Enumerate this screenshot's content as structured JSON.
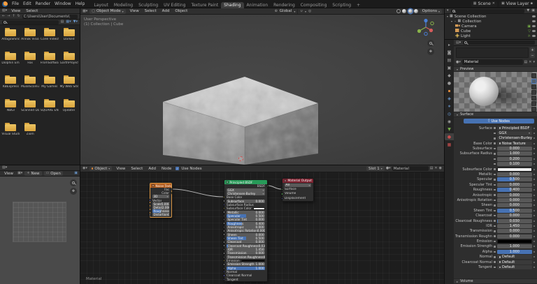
{
  "topbar": {
    "menus": [
      "File",
      "Edit",
      "Render",
      "Window",
      "Help"
    ],
    "tabs": [
      "Layout",
      "Modeling",
      "Sculpting",
      "UV Editing",
      "Texture Paint",
      "Shading",
      "Animation",
      "Rendering",
      "Compositing",
      "Scripting"
    ],
    "active_tab": "Shading",
    "add_tab": "+",
    "scene": "Scene",
    "view_layer": "View Layer"
  },
  "file_browser": {
    "menus": [
      "View",
      "Select"
    ],
    "path": "C:\\Users\\User\\Documents\\",
    "folders": [
      "AltagoShinc",
      "Annok Vision",
      "Corel VideoSt..",
      "Darked",
      "Dolphin Emul..",
      "Fax",
      "FromSoftware",
      "GarthProject",
      "KBExpress",
      "MuseScore3",
      "My Games",
      "My Web Sites",
      "NBGI",
      "Scanned Doc..",
      "SQUARE ENIX",
      "Updater",
      "Visual Studi..",
      "Ziom"
    ]
  },
  "viewport": {
    "mode": "Object Mode",
    "menus": [
      "View",
      "Select",
      "Add",
      "Object"
    ],
    "orientation": "Global",
    "options": "Options",
    "overlay_line1": "User Perspective",
    "overlay_line2": "(1) Collection | Cube"
  },
  "image_editor": {
    "view_menu": "View",
    "new_button": "New",
    "open_button": "Open"
  },
  "node_editor": {
    "shader_type": "Object",
    "menus": [
      "View",
      "Select",
      "Add",
      "Node"
    ],
    "use_nodes": "Use Nodes",
    "slot": "Slot 1",
    "material_name": "Material",
    "breadcrumb": "Material",
    "noise_node": {
      "title": "Noise Texture",
      "outputs": [
        {
          "label": "Fac",
          "socket": "value"
        },
        {
          "label": "Color",
          "socket": "color"
        }
      ],
      "dimensions": "3D",
      "rows": [
        {
          "label": "Vector",
          "kind": "plain",
          "socket": "vector"
        },
        {
          "label": "Scale",
          "value": "5.000",
          "kind": "slider",
          "fill": 0,
          "socket": "value"
        },
        {
          "label": "Detail",
          "value": "2.000",
          "kind": "slider",
          "fill": 0,
          "socket": "value"
        },
        {
          "label": "Roughness",
          "value": "0.500",
          "kind": "slider",
          "fill": 50,
          "socket": "value"
        },
        {
          "label": "Distortion",
          "value": "0.000",
          "kind": "slider",
          "fill": 0,
          "socket": "value"
        }
      ]
    },
    "bsdf_node": {
      "title": "Principled BSDF",
      "output": {
        "label": "BSDF",
        "socket": "shader"
      },
      "rows": [
        {
          "label": "GGX",
          "kind": "dropdown"
        },
        {
          "label": "Christensen-Burley",
          "kind": "dropdown"
        },
        {
          "label": "Base Color",
          "kind": "plain",
          "socket": "color"
        },
        {
          "label": "Subsurface",
          "value": "0.000",
          "kind": "slider",
          "fill": 0,
          "socket": "value"
        },
        {
          "label": "Subsurface Radius",
          "kind": "plain",
          "socket": "vector"
        },
        {
          "label": "Subsurface Color",
          "kind": "color",
          "color": "#f0f0f0",
          "socket": "color"
        },
        {
          "label": "Metallic",
          "value": "0.000",
          "kind": "slider",
          "fill": 0,
          "socket": "value"
        },
        {
          "label": "Specular",
          "value": "0.500",
          "kind": "slider",
          "fill": 50,
          "socket": "value"
        },
        {
          "label": "Specular Tint",
          "value": "0.000",
          "kind": "slider",
          "fill": 0,
          "socket": "value"
        },
        {
          "label": "Roughness",
          "value": "0.400",
          "kind": "slider",
          "fill": 40,
          "socket": "value"
        },
        {
          "label": "Anisotropic",
          "value": "0.000",
          "kind": "slider",
          "fill": 0,
          "socket": "value"
        },
        {
          "label": "Anisotropic Rotation",
          "value": "0.000",
          "kind": "slider",
          "fill": 0,
          "socket": "value"
        },
        {
          "label": "Sheen",
          "value": "0.000",
          "kind": "slider",
          "fill": 0,
          "socket": "value"
        },
        {
          "label": "Sheen Tint",
          "value": "0.500",
          "kind": "slider",
          "fill": 50,
          "socket": "value"
        },
        {
          "label": "Clearcoat",
          "value": "0.000",
          "kind": "slider",
          "fill": 0,
          "socket": "value"
        },
        {
          "label": "Clearcoat Roughness",
          "value": "0.030",
          "kind": "slider",
          "fill": 3,
          "socket": "value"
        },
        {
          "label": "IOR",
          "value": "1.450",
          "kind": "slider",
          "fill": 0,
          "socket": "value"
        },
        {
          "label": "Transmission",
          "value": "0.000",
          "kind": "slider",
          "fill": 0,
          "socket": "value"
        },
        {
          "label": "Transmission Roughness",
          "value": "0.000",
          "kind": "slider",
          "fill": 0,
          "socket": "value"
        },
        {
          "label": "Emission",
          "kind": "color",
          "color": "#000000",
          "socket": "color"
        },
        {
          "label": "Emission Strength",
          "value": "1.000",
          "kind": "slider",
          "fill": 0,
          "socket": "value"
        },
        {
          "label": "Alpha",
          "value": "1.000",
          "kind": "slider",
          "fill": 100,
          "socket": "value"
        },
        {
          "label": "Normal",
          "kind": "plain",
          "socket": "vector"
        },
        {
          "label": "Clearcoat Normal",
          "kind": "plain",
          "socket": "vector"
        },
        {
          "label": "Tangent",
          "kind": "plain",
          "socket": "vector"
        }
      ]
    },
    "output_node": {
      "title": "Material Output",
      "target": "All",
      "inputs": [
        {
          "label": "Surface",
          "socket": "shader"
        },
        {
          "label": "Volume",
          "socket": "shader"
        },
        {
          "label": "Displacement",
          "socket": "vector"
        }
      ]
    }
  },
  "outliner": {
    "rows": [
      {
        "label": "Scene Collection",
        "depth": 0,
        "icon": "scene-collection",
        "arrow": true
      },
      {
        "label": "Collection",
        "depth": 1,
        "icon": "collection",
        "arrow": true,
        "checkbox": true
      },
      {
        "label": "Camera",
        "depth": 2,
        "icon": "camera",
        "data_icon": "camera-data"
      },
      {
        "label": "Cube",
        "depth": 2,
        "icon": "mesh",
        "data_icon": "mesh-data"
      },
      {
        "label": "Light",
        "depth": 2,
        "icon": "light",
        "data_icon": "light-data"
      }
    ]
  },
  "properties": {
    "tabs": [
      {
        "name": "tool",
        "glyph": "▸",
        "color": "#9a9a9a"
      },
      {
        "name": "render",
        "glyph": "◙",
        "color": "#9a9a9a"
      },
      {
        "name": "output",
        "glyph": "▤",
        "color": "#9a9a9a"
      },
      {
        "name": "view-layer",
        "glyph": "▣",
        "color": "#9a9a9a"
      },
      {
        "name": "scene",
        "glyph": "◆",
        "color": "#9a9a9a"
      },
      {
        "name": "world",
        "glyph": "●",
        "color": "#9a9a9a"
      },
      {
        "name": "object",
        "glyph": "▪",
        "color": "#d8863b"
      },
      {
        "name": "modifiers",
        "glyph": "◈",
        "color": "#6b9bd2"
      },
      {
        "name": "particles",
        "glyph": "∗",
        "color": "#6b9bd2"
      },
      {
        "name": "physics",
        "glyph": "◎",
        "color": "#6b9bd2"
      },
      {
        "name": "constraints",
        "glyph": "◉",
        "color": "#9a9a9a"
      },
      {
        "name": "object-data",
        "glyph": "▼",
        "color": "#76b04a"
      },
      {
        "name": "material",
        "glyph": "●",
        "color": "#cc4f4f",
        "active": true
      },
      {
        "name": "texture",
        "glyph": "▦",
        "color": "#cc4f4f"
      }
    ],
    "material_name": "Material",
    "preview_label": "Preview",
    "surface_label": "Surface",
    "volume_label": "Volume",
    "use_nodes": "Use Nodes",
    "rows": [
      {
        "label": "Surface",
        "value": "Principled BSDF",
        "kind": "menu"
      },
      {
        "label": "",
        "value": "GGX",
        "kind": "dropdown"
      },
      {
        "label": "",
        "value": "Christensen-Burley",
        "kind": "dropdown"
      },
      {
        "label": "Base Color",
        "value": "Noise Texture",
        "kind": "menu"
      },
      {
        "label": "Subsurface",
        "value": "0.000",
        "kind": "slider",
        "fill": 0
      },
      {
        "label": "Subsurface Radius",
        "value": "1.000",
        "kind": "slider",
        "fill": 0
      },
      {
        "label": "",
        "value": "0.200",
        "kind": "slider",
        "fill": 0
      },
      {
        "label": "",
        "value": "0.100",
        "kind": "slider",
        "fill": 0
      },
      {
        "label": "Subsurface Color",
        "kind": "color",
        "color": "#f0f0f0"
      },
      {
        "label": "Metallic",
        "value": "0.000",
        "kind": "slider",
        "fill": 0
      },
      {
        "label": "Specular",
        "value": "0.500",
        "kind": "slider",
        "fill": 50
      },
      {
        "label": "Specular Tint",
        "value": "0.000",
        "kind": "slider",
        "fill": 0
      },
      {
        "label": "Roughness",
        "value": "0.400",
        "kind": "slider",
        "fill": 40
      },
      {
        "label": "Anisotropic",
        "value": "0.000",
        "kind": "slider",
        "fill": 0
      },
      {
        "label": "Anisotropic Rotation",
        "value": "0.000",
        "kind": "slider",
        "fill": 0
      },
      {
        "label": "Sheen",
        "value": "0.000",
        "kind": "slider",
        "fill": 0
      },
      {
        "label": "Sheen Tint",
        "value": "0.500",
        "kind": "slider",
        "fill": 50
      },
      {
        "label": "Clearcoat",
        "value": "0.000",
        "kind": "slider",
        "fill": 0
      },
      {
        "label": "Clearcoat Roughness",
        "value": "0.030",
        "kind": "slider",
        "fill": 3
      },
      {
        "label": "IOR",
        "value": "1.450",
        "kind": "slider",
        "fill": 0
      },
      {
        "label": "Transmission",
        "value": "0.000",
        "kind": "slider",
        "fill": 0
      },
      {
        "label": "Transmission Roughness",
        "value": "0.000",
        "kind": "slider",
        "fill": 0
      },
      {
        "label": "Emission",
        "kind": "color",
        "color": "#000000"
      },
      {
        "label": "Emission Strength",
        "value": "1.000",
        "kind": "slider",
        "fill": 0
      },
      {
        "label": "Alpha",
        "value": "1.000",
        "kind": "slider",
        "fill": 100
      },
      {
        "label": "Normal",
        "value": "Default",
        "kind": "menu"
      },
      {
        "label": "Clearcoat Normal",
        "value": "Default",
        "kind": "menu"
      },
      {
        "label": "Tangent",
        "value": "Default",
        "kind": "menu"
      }
    ]
  },
  "colors": {
    "accent_blue": "#4772b3",
    "texture_node_header": "#b85f1e",
    "shader_node_header": "#279a58",
    "output_node_header": "#7e2230",
    "folder": "#ddab44"
  }
}
